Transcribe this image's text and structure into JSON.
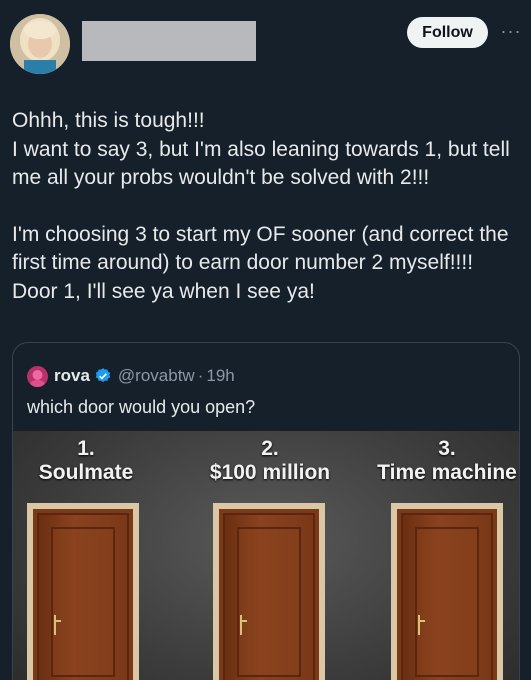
{
  "header": {
    "follow_label": "Follow",
    "more_label": "···"
  },
  "tweet": {
    "line1": "Ohhh, this is tough!!!",
    "line2": "I want to say 3, but I'm also leaning towards 1, but tell me all your probs wouldn't be solved with 2!!!",
    "line3": "I'm choosing 3 to start my OF sooner (and correct the first time around) to earn door number 2 myself!!!! Door 1, I'll see ya when I see ya!"
  },
  "quote": {
    "name": "rova",
    "handle": "@rovabtw",
    "dot": "·",
    "time": "19h",
    "text": "which door would you open?",
    "doors": [
      {
        "number": "1.",
        "title": "Soulmate"
      },
      {
        "number": "2.",
        "title": "$100 million"
      },
      {
        "number": "3.",
        "title": "Time machine"
      }
    ]
  },
  "icons": {
    "more": "more-horizontal-icon",
    "verified": "verified-badge-icon"
  },
  "colors": {
    "background": "#15202b",
    "text": "#e7e9ea",
    "secondary": "#8b98a5",
    "verified": "#1d9bf0",
    "follow_bg": "#eff3f4"
  }
}
